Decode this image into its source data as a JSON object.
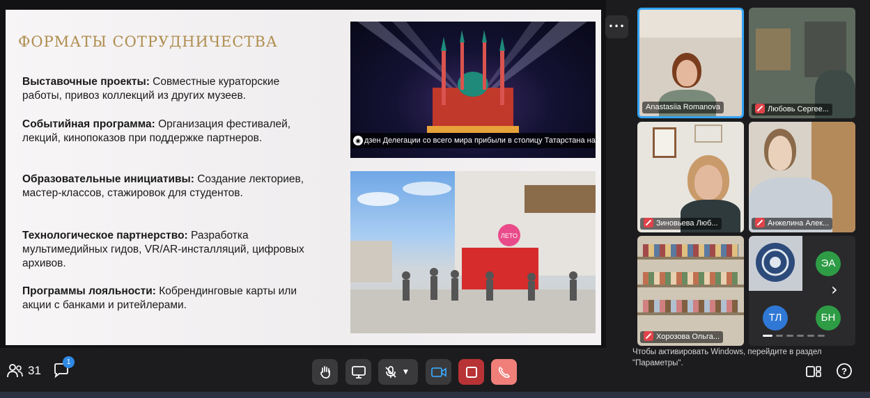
{
  "slide": {
    "title": "ФОРМАТЫ СОТРУДНИЧЕСТВА",
    "formats": [
      {
        "label": "Выставочные проекты:",
        "text": " Совместные кураторские работы, привоз коллекций из других музеев."
      },
      {
        "label": "Событийная программа:",
        "text": " Организация фестивалей, лекций, кинопоказов при поддержке партнеров."
      },
      {
        "label": "Образовательные инициативы:",
        "text": " Создание лекториев, мастер-классов, стажировок для студентов."
      },
      {
        "label": "Технологическое партнерство:",
        "text": " Разработка мультимедийных гидов, VR/AR-инсталляций, цифровых архивов."
      },
      {
        "label": "Программы лояльности:",
        "text": " Кобрендинговые карты или акции с банками и ритейлерами."
      }
    ],
    "photo1_source": "дзен",
    "photo1_caption": "Делегации со всего мира прибыли в столицу Татарстана на КазаньФорум",
    "photo2_sign": "ЛЕТО"
  },
  "participants": [
    {
      "name": "Anastasiia Romanova",
      "muted": false,
      "active": true
    },
    {
      "name": "Любовь Сергее...",
      "muted": true,
      "active": false
    },
    {
      "name": "Зиновьева Люб...",
      "muted": true,
      "active": false
    },
    {
      "name": "Анжелина Алек...",
      "muted": true,
      "active": false
    },
    {
      "name": "Хорозова Ольга...",
      "muted": true,
      "active": false
    }
  ],
  "avatars": [
    {
      "initials": "ЭА",
      "color": "#2e9c45"
    },
    {
      "initials": "ТЛ",
      "color": "#2f78d6"
    },
    {
      "initials": "БН",
      "color": "#2e9c45"
    }
  ],
  "toolbar": {
    "participants_count": "31",
    "chat_badge": "1",
    "more_label": "•••"
  },
  "watermark": {
    "line1": "Чтобы активировать Windows, перейдите в раздел",
    "line2": "\"Параметры\"."
  }
}
